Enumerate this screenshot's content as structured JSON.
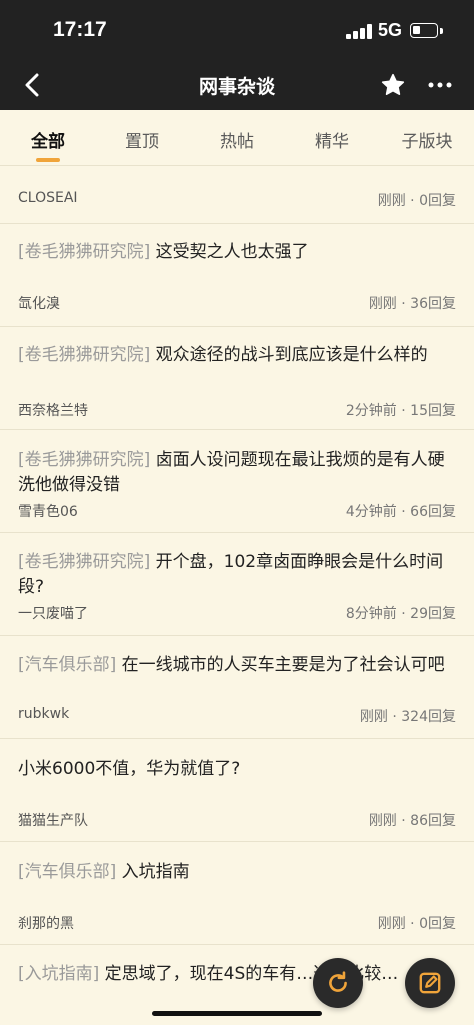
{
  "status": {
    "time": "17:17",
    "network": "5G"
  },
  "nav": {
    "title": "网事杂谈"
  },
  "tabs": [
    {
      "label": "全部",
      "active": true
    },
    {
      "label": "置顶"
    },
    {
      "label": "热帖"
    },
    {
      "label": "精华"
    },
    {
      "label": "子版块"
    }
  ],
  "posts": [
    {
      "tag": "",
      "title": "CLOSEAI",
      "author": "",
      "time": "刚刚",
      "replies": "0回复"
    },
    {
      "tag": "[卷毛狒狒研究院]",
      "title": "这受契之人也太强了",
      "author": "氙化溴",
      "time": "刚刚",
      "replies": "36回复"
    },
    {
      "tag": "[卷毛狒狒研究院]",
      "title": "观众途径的战斗到底应该是什么样的",
      "author": "西奈格兰特",
      "time": "2分钟前",
      "replies": "15回复"
    },
    {
      "tag": "[卷毛狒狒研究院]",
      "title": "卤面人设问题现在最让我烦的是有人硬洗他做得没错",
      "author": "雪青色06",
      "time": "4分钟前",
      "replies": "66回复"
    },
    {
      "tag": "[卷毛狒狒研究院]",
      "title": "开个盘，102章卤面睁眼会是什么时间段?",
      "author": "一只废喵了",
      "time": "8分钟前",
      "replies": "29回复"
    },
    {
      "tag": "[汽车俱乐部]",
      "title": "在一线城市的人买车主要是为了社会认可吧",
      "author": "rubkwk",
      "time": "刚刚",
      "replies": "324回复"
    },
    {
      "tag": "",
      "title": "小米6000不值，华为就值了?",
      "author": "猫猫生产队",
      "time": "刚刚",
      "replies": "86回复"
    },
    {
      "tag": "[汽车俱乐部]",
      "title": "入坑指南",
      "author": "刹那的黑",
      "time": "刚刚",
      "replies": "0回复"
    },
    {
      "tag": "[入坑指南]",
      "title": "定思域了，现在4S的车有…选择比较…",
      "author": "",
      "time": "",
      "replies": ""
    }
  ],
  "colors": {
    "bar": "#222222",
    "background": "#FBF6E4",
    "accent": "#F0A43A"
  },
  "icons": {
    "back": "chevron-left-icon",
    "favorite": "star-icon",
    "more": "more-dots-icon",
    "refresh": "refresh-icon",
    "compose": "compose-icon"
  }
}
